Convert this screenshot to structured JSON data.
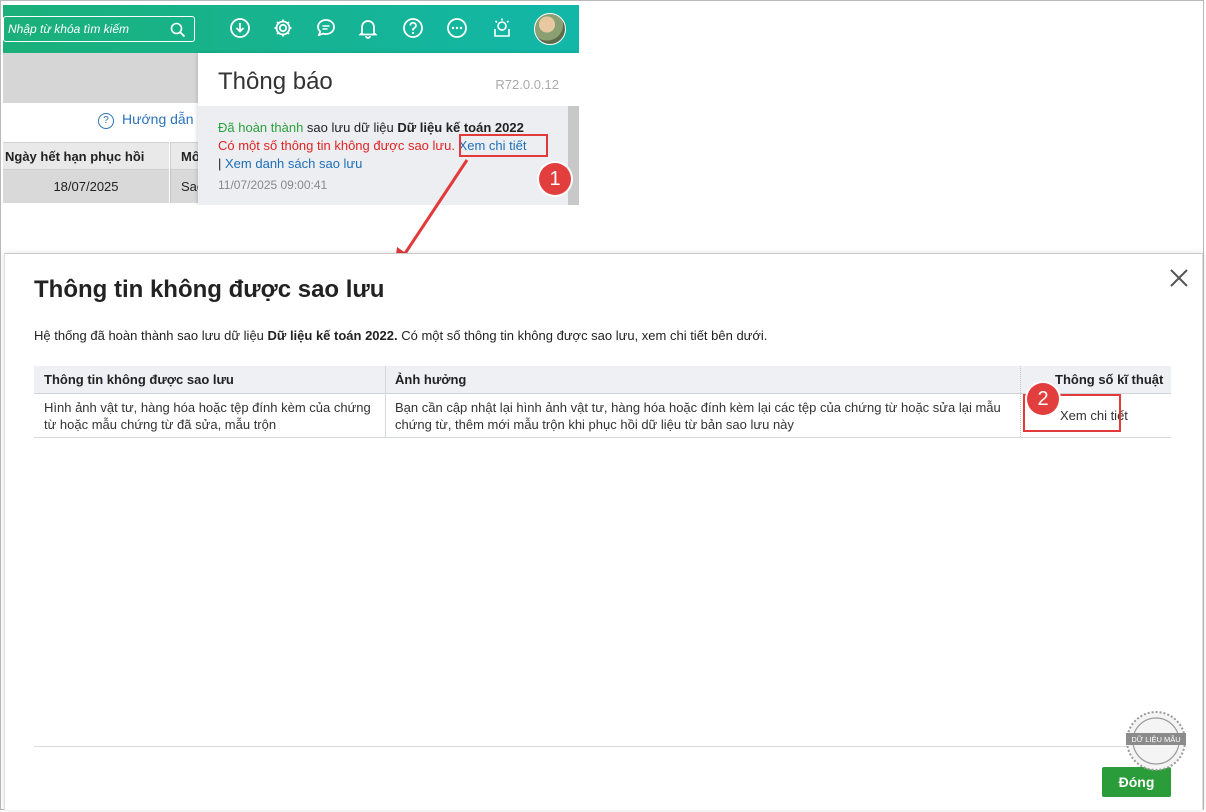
{
  "topbar": {
    "search_placeholder": "Nhập từ khóa tìm kiếm",
    "icons": [
      "download-icon",
      "gear-icon",
      "chat-icon",
      "bell-icon",
      "help-icon",
      "more-icon",
      "lightbulb-icon",
      "avatar"
    ],
    "colors": {
      "gradient_start": "#1bb07a",
      "gradient_end": "#12b7a8"
    }
  },
  "background": {
    "guide_link": "Hướng dẫn s",
    "col1_header": "Ngày hết hạn phục hồi",
    "col2_header": "Mô",
    "col1_value": "18/07/2025",
    "col2_value": "Sao"
  },
  "notification": {
    "title": "Thông báo",
    "version": "R72.0.0.12",
    "status_done": "Đã hoàn thành",
    "status_text": "sao lưu dữ liệu",
    "database_name": "Dữ liệu kế toán 2022",
    "warning": "Có một số thông tin không được sao lưu.",
    "detail_link": "Xem chi tiết",
    "separator": "|",
    "list_link": "Xem danh sách sao lưu",
    "timestamp": "11/07/2025 09:00:41"
  },
  "callouts": {
    "step1": "1",
    "step2": "2",
    "highlight_color": "#e23a3a"
  },
  "dialog": {
    "title": "Thông tin không được sao lưu",
    "desc_prefix": "Hệ thống đã hoàn thành sao lưu dữ liệu",
    "desc_db": "Dữ liệu kế toán 2022.",
    "desc_suffix": "Có một số thông tin không được sao lưu, xem chi tiết bên dưới.",
    "columns": [
      "Thông tin không được sao lưu",
      "Ảnh hưởng",
      "Thông số kĩ thuật"
    ],
    "rows": [
      {
        "info": "Hình ảnh vật tư, hàng hóa hoặc tệp đính kèm của chứng từ hoặc mẫu chứng từ đã sửa, mẫu trộn",
        "impact": "Bạn cần cập nhật lại hình ảnh vật tư, hàng hóa hoặc đính kèm lại các tệp của chứng từ hoặc sửa lại mẫu chứng từ, thêm mới mẫu trộn khi phục hồi dữ liệu từ bản sao lưu này",
        "spec_link": "Xem chi tiết"
      }
    ],
    "close_button": "Đóng",
    "close_button_color": "#2a9d3a"
  },
  "stamp": {
    "text": "DỮ LIỆU MẪU"
  }
}
